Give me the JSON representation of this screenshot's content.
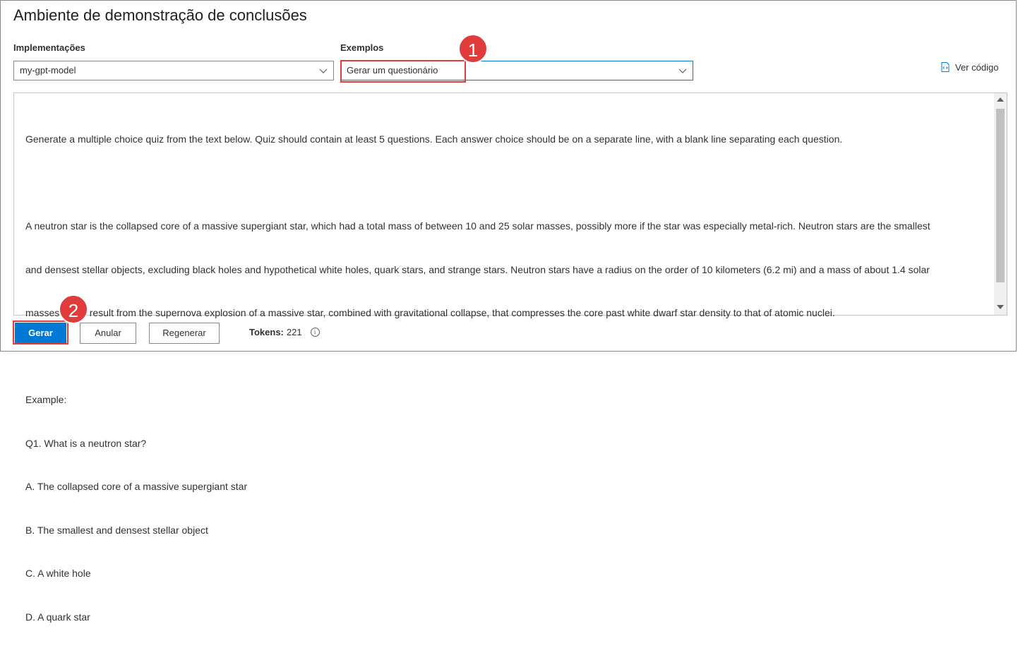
{
  "title": "Ambiente de demonstração de conclusões",
  "deployments": {
    "label": "Implementações",
    "value": "my-gpt-model"
  },
  "examples": {
    "label": "Exemplos",
    "value": "Gerar um questionário"
  },
  "view_code": "Ver código",
  "prompt_lines": [
    "Generate a multiple choice quiz from the text below. Quiz should contain at least 5 questions. Each answer choice should be on a separate line, with a blank line separating each question.",
    "",
    "A neutron star is the collapsed core of a massive supergiant star, which had a total mass of between 10 and 25 solar masses, possibly more if the star was especially metal-rich. Neutron stars are the smallest",
    "and densest stellar objects, excluding black holes and hypothetical white holes, quark stars, and strange stars. Neutron stars have a radius on the order of 10 kilometers (6.2 mi) and a mass of about 1.4 solar",
    "masses. They result from the supernova explosion of a massive star, combined with gravitational collapse, that compresses the core past white dwarf star density to that of atomic nuclei.",
    "",
    "Example:",
    "Q1. What is a neutron star?",
    "A. The collapsed core of a massive supergiant star",
    "B. The smallest and densest stellar object",
    "C. A white hole",
    "D. A quark star"
  ],
  "buttons": {
    "generate": "Gerar",
    "undo": "Anular",
    "regenerate": "Regenerar"
  },
  "tokens": {
    "label": "Tokens:",
    "value": "221"
  },
  "callouts": {
    "one": "1",
    "two": "2"
  },
  "colors": {
    "accent": "#0078d4",
    "callout": "#e03c3c"
  }
}
